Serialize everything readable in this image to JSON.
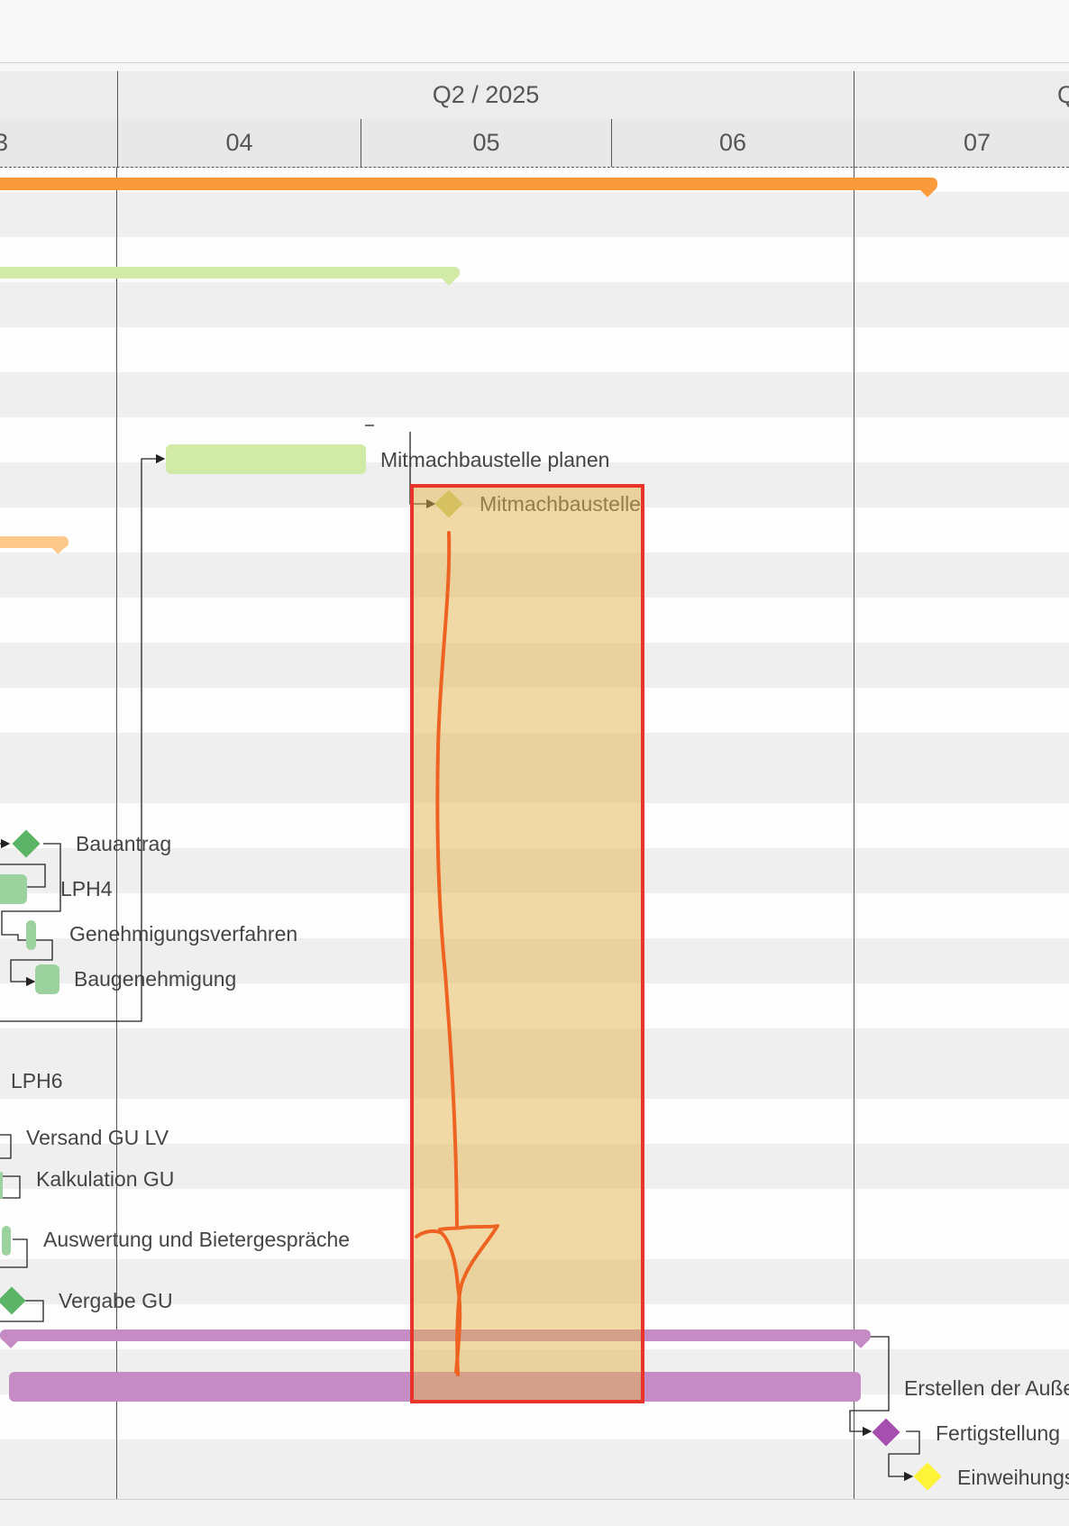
{
  "timeline": {
    "quarters": [
      {
        "label": "",
        "name": "quarter-previous"
      },
      {
        "label": "Q2 / 2025",
        "name": "quarter-q2-2025"
      },
      {
        "label": "Q",
        "name": "quarter-next"
      }
    ],
    "months": [
      {
        "label": "3",
        "name": "month-03"
      },
      {
        "label": "04",
        "name": "month-04"
      },
      {
        "label": "05",
        "name": "month-05"
      },
      {
        "label": "06",
        "name": "month-06"
      },
      {
        "label": "07",
        "name": "month-07"
      }
    ]
  },
  "tasks": {
    "mitmachbaustelle_planen": "Mitmachbaustelle planen",
    "mitmachbaustelle": "Mitmachbaustelle",
    "bauantrag": "Bauantrag",
    "lph4": "LPH4",
    "genehmigungsverfahren": "Genehmigungsverfahren",
    "baugenehmigung": "Baugenehmigung",
    "lph6": "LPH6",
    "versand_gu_lv": "Versand GU LV",
    "kalkulation_gu": "Kalkulation GU",
    "auswertung": "Auswertung und Bietergespräche",
    "vergabe_gu": "Vergabe GU",
    "erstellen": "Erstellen der Auße",
    "fertigstellung": "Fertigstellung",
    "einweihung": "Einweihungs"
  },
  "colors": {
    "orange": "#fb9a3a",
    "light_orange": "#fdc98a",
    "light_green": "#d1eba7",
    "green": "#9bd29e",
    "green_milestone": "#5cb566",
    "purple_bar": "#c48bc4",
    "purple_milestone": "#a64fae",
    "yellow_milestone": "#fdf43a",
    "olive_milestone": "#c9cb6e",
    "annotation_red": "#e9342a",
    "annotation_fill": "#e5b54f",
    "annotation_stroke": "#ee6322"
  }
}
